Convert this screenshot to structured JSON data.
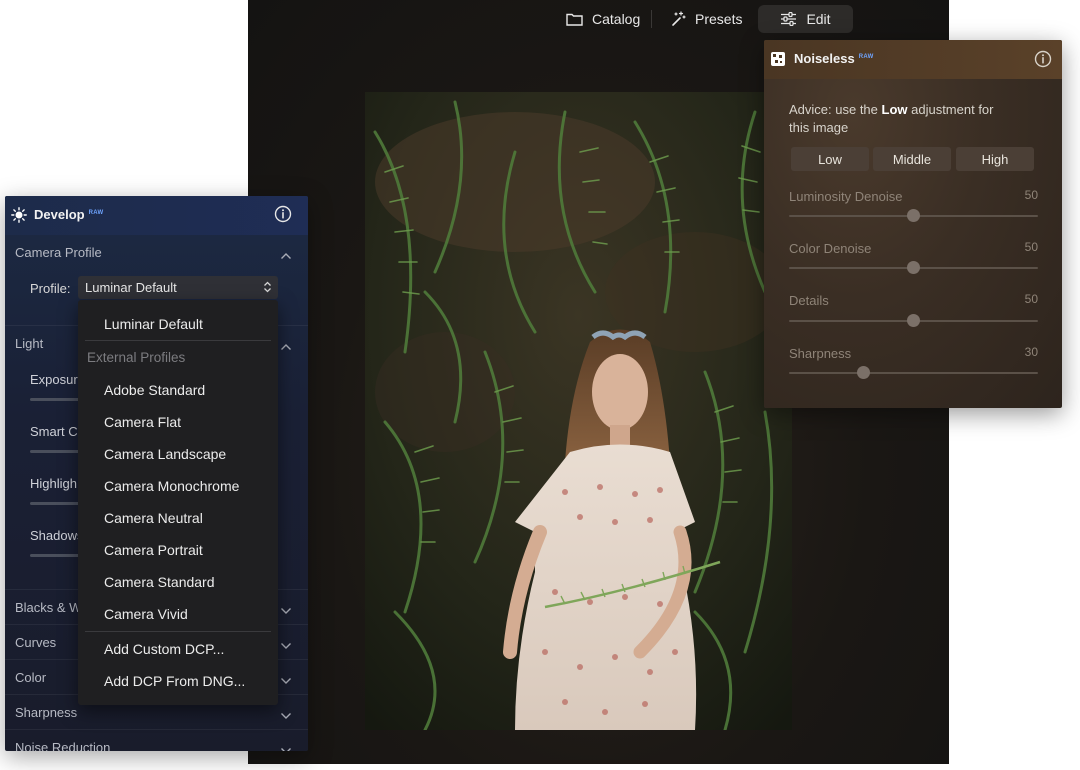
{
  "topbar": {
    "tabs": [
      {
        "label": "Catalog",
        "icon": "folder-icon"
      },
      {
        "label": "Presets",
        "icon": "magic-wand-icon"
      },
      {
        "label": "Edit",
        "icon": "sliders-icon",
        "active": true
      }
    ]
  },
  "develop": {
    "title": "Develop",
    "badge": "RAW",
    "sections": {
      "camera_profile": "Camera Profile",
      "light": "Light",
      "blacks_whites": "Blacks & W",
      "curves": "Curves",
      "color": "Color",
      "sharpness": "Sharpness",
      "noise_reduction": "Noise Reduction"
    },
    "profile_label": "Profile:",
    "profile_value": "Luminar Default",
    "light_sliders": [
      "Exposure",
      "Smart Co",
      "Highligh",
      "Shadows"
    ]
  },
  "profile_dropdown": {
    "first_item": "Luminar Default",
    "heading": "External Profiles",
    "items": [
      "Adobe Standard",
      "Camera Flat",
      "Camera Landscape",
      "Camera Monochrome",
      "Camera Neutral",
      "Camera Portrait",
      "Camera Standard",
      "Camera Vivid"
    ],
    "actions": [
      "Add Custom DCP...",
      "Add DCP From DNG..."
    ]
  },
  "noiseless": {
    "title": "Noiseless",
    "badge": "RAW",
    "advice_prefix": "Advice: use the ",
    "advice_strong": "Low",
    "advice_suffix": " adjustment for this image",
    "buttons": [
      "Low",
      "Middle",
      "High"
    ],
    "sliders": [
      {
        "label": "Luminosity Denoise",
        "value": "50",
        "fraction": 0.5
      },
      {
        "label": "Color Denoise",
        "value": "50",
        "fraction": 0.5
      },
      {
        "label": "Details",
        "value": "50",
        "fraction": 0.5
      },
      {
        "label": "Sharpness",
        "value": "30",
        "fraction": 0.3
      }
    ]
  },
  "colors": {
    "develop_accent": "#6fa4ff",
    "noiseless_bg": "#3a2e24",
    "app_bg": "#1a1714"
  }
}
